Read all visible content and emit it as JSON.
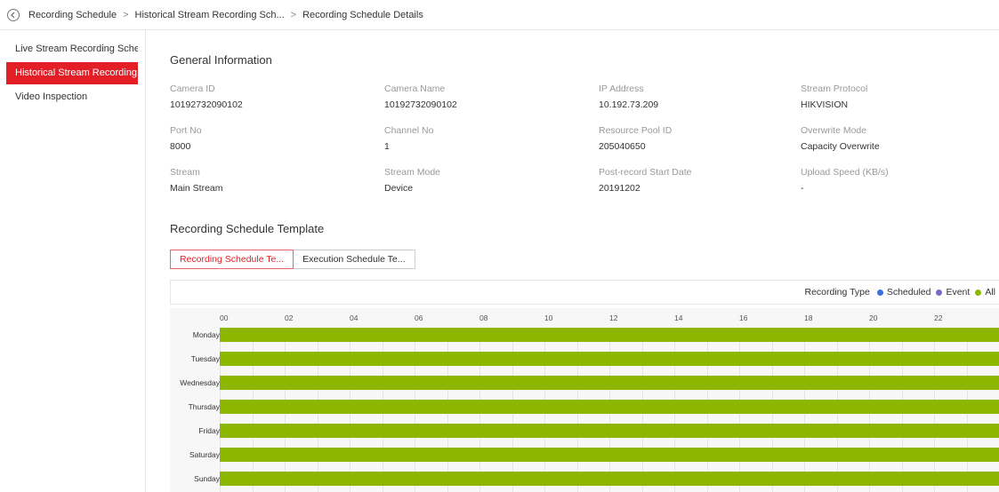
{
  "breadcrumb": {
    "items": [
      "Recording Schedule",
      "Historical Stream Recording Sch...",
      "Recording Schedule Details"
    ]
  },
  "sidebar": {
    "items": [
      {
        "label": "Live Stream Recording Sched...",
        "active": false
      },
      {
        "label": "Historical Stream Recording...",
        "active": true
      },
      {
        "label": "Video Inspection",
        "active": false
      }
    ]
  },
  "general": {
    "title": "General Information",
    "fields": [
      {
        "label": "Camera ID",
        "value": "10192732090102"
      },
      {
        "label": "Camera Name",
        "value": "10192732090102"
      },
      {
        "label": "IP Address",
        "value": "10.192.73.209"
      },
      {
        "label": "Stream Protocol",
        "value": "HIKVISION"
      },
      {
        "label": "Port No",
        "value": "8000"
      },
      {
        "label": "Channel No",
        "value": "1"
      },
      {
        "label": "Resource Pool ID",
        "value": "205040650"
      },
      {
        "label": "Overwrite Mode",
        "value": "Capacity Overwrite"
      },
      {
        "label": "Stream",
        "value": "Main Stream"
      },
      {
        "label": "Stream Mode",
        "value": "Device"
      },
      {
        "label": "Post-record Start Date",
        "value": "20191202"
      },
      {
        "label": "Upload Speed (KB/s)",
        "value": "-"
      }
    ]
  },
  "template": {
    "title": "Recording Schedule Template",
    "tabs": [
      {
        "label": "Recording Schedule Te...",
        "active": true
      },
      {
        "label": "Execution Schedule Te...",
        "active": false
      }
    ],
    "legend": {
      "label": "Recording Type",
      "items": [
        {
          "label": "Scheduled",
          "color": "#3b6fdc",
          "icon": "scheduled-dot-icon"
        },
        {
          "label": "Event",
          "color": "#7b68c8",
          "icon": "event-dot-icon"
        },
        {
          "label": "All",
          "color": "#8db600",
          "icon": "all-dot-icon"
        }
      ]
    },
    "hours": [
      "00",
      "02",
      "04",
      "06",
      "08",
      "10",
      "12",
      "14",
      "16",
      "18",
      "20",
      "22"
    ],
    "days": [
      "Monday",
      "Tuesday",
      "Wednesday",
      "Thursday",
      "Friday",
      "Saturday",
      "Sunday"
    ],
    "schedule": [
      {
        "day": "Monday",
        "type": "All",
        "start": "00:00",
        "end": "24:00"
      },
      {
        "day": "Tuesday",
        "type": "All",
        "start": "00:00",
        "end": "24:00"
      },
      {
        "day": "Wednesday",
        "type": "All",
        "start": "00:00",
        "end": "24:00"
      },
      {
        "day": "Thursday",
        "type": "All",
        "start": "00:00",
        "end": "24:00"
      },
      {
        "day": "Friday",
        "type": "All",
        "start": "00:00",
        "end": "24:00"
      },
      {
        "day": "Saturday",
        "type": "All",
        "start": "00:00",
        "end": "24:00"
      },
      {
        "day": "Sunday",
        "type": "All",
        "start": "00:00",
        "end": "24:00"
      }
    ]
  },
  "colors": {
    "accent": "#e41e26",
    "all": "#8db600"
  }
}
